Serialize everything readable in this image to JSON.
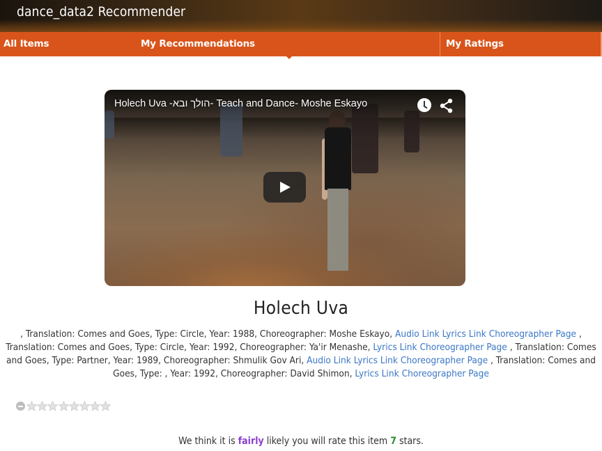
{
  "header": {
    "title": "dance_data2 Recommender"
  },
  "nav": {
    "all_items": "All Items",
    "my_recommendations": "My Recommendations",
    "my_ratings": "My Ratings"
  },
  "video": {
    "title": "Holech Uva -הולך ובא- Teach and Dance- Moshe Eskayo",
    "icons": [
      "clock-icon",
      "share-icon",
      "play-icon"
    ]
  },
  "item": {
    "name": "Holech Uva",
    "details": [
      {
        "text": ", Translation: Comes and Goes, Type: Circle, Year: 1988, Choreographer: Moshe Eskayo, "
      },
      {
        "link": "Audio Link"
      },
      {
        "text": " "
      },
      {
        "link": "Lyrics Link"
      },
      {
        "text": " "
      },
      {
        "link": "Choreographer Page"
      },
      {
        "text": " , Translation: Comes and Goes, Type: Circle, Year: 1992, Choreographer: Ya'ir Menashe, "
      },
      {
        "link": "Lyrics Link"
      },
      {
        "text": " "
      },
      {
        "link": "Choreographer Page"
      },
      {
        "text": " , Translation: Comes and Goes, Type: Partner, Year: 1989, Choreographer: Shmulik Gov Ari, "
      },
      {
        "link": "Audio Link"
      },
      {
        "text": " "
      },
      {
        "link": "Lyrics Link"
      },
      {
        "text": " "
      },
      {
        "link": "Choreographer Page"
      },
      {
        "text": " , Translation: Comes and Goes, Type: , Year: 1992, Choreographer: David Shimon, "
      },
      {
        "link": "Lyrics Link"
      },
      {
        "text": " "
      },
      {
        "link": "Choreographer Page"
      }
    ]
  },
  "rating": {
    "current": 0,
    "max": 8,
    "icons": [
      "clear-rating-icon",
      "star-icon"
    ]
  },
  "prediction": {
    "prefix": "We think it is",
    "level": "fairly",
    "middle": "likely you will rate this item",
    "stars": "7",
    "suffix": "stars."
  },
  "colors": {
    "nav_bg": "#d9541a",
    "link": "#3a77c5",
    "level": "#8a3fd1",
    "stars": "#2e8b2e"
  }
}
